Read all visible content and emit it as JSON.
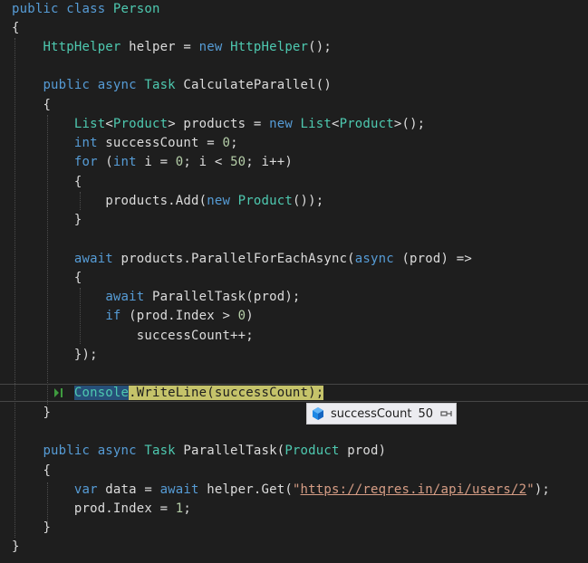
{
  "code": {
    "l1": {
      "kw1": "public",
      "kw2": "class",
      "name": "Person"
    },
    "l2": {
      "brace": "{"
    },
    "l3": {
      "type": "HttpHelper",
      "rest": " helper = ",
      "kw": "new",
      "type2": "HttpHelper",
      "end": "();"
    },
    "l4": {
      "kw1": "public",
      "kw2": "async",
      "type": "Task",
      "rest": " CalculateParallel()"
    },
    "l5": {
      "brace": "{"
    },
    "l6": {
      "type": "List",
      "lt": "<",
      "type2": "Product",
      "gt": "> products = ",
      "kw": "new",
      "type3": "List",
      "lt2": "<",
      "type4": "Product",
      "end": ">();"
    },
    "l7": {
      "kw": "int",
      "rest": " successCount = ",
      "num": "0",
      "end": ";"
    },
    "l8": {
      "kw": "for",
      "p1": " (",
      "kw2": "int",
      "p2": " i = ",
      "n1": "0",
      "p3": "; i < ",
      "n2": "50",
      "p4": "; i++)"
    },
    "l9": {
      "brace": "{"
    },
    "l10": {
      "pre": "products.Add(",
      "kw": "new",
      "sp": " ",
      "type": "Product",
      "end": "());"
    },
    "l11": {
      "brace": "}"
    },
    "l12": {
      "kw": "await",
      "pre": " products.ParallelForEachAsync(",
      "kw2": "async",
      "end": " (prod) =>"
    },
    "l13": {
      "brace": "{"
    },
    "l14": {
      "kw": "await",
      "rest": " ParallelTask(prod);"
    },
    "l15": {
      "kw": "if",
      "pre": " (prod.Index > ",
      "num": "0",
      "end": ")"
    },
    "l16": {
      "text": "successCount++;"
    },
    "l17": {
      "text": "});"
    },
    "l18": {
      "cls": "Console",
      "rest": ".WriteLine(successCount);"
    },
    "l19": {
      "brace": "}"
    },
    "l20": {
      "kw1": "public",
      "kw2": "async",
      "type": "Task",
      "pre": " ParallelTask(",
      "type2": "Product",
      "end": " prod)"
    },
    "l21": {
      "brace": "{"
    },
    "l22": {
      "kw": "var",
      "pre": " data = ",
      "kw2": "await",
      "mid": " helper.Get(",
      "q1": "\"",
      "url": "https://reqres.in/api/users/2",
      "q2": "\"",
      "end": ");"
    },
    "l23": {
      "text": "prod.Index = ",
      "num": "1",
      "end": ";"
    },
    "l24": {
      "brace": "}"
    },
    "l25": {
      "brace": "}"
    }
  },
  "datatip": {
    "name": "successCount",
    "value": "50",
    "icon": "variable-cube-icon",
    "pin_icon": "pin-icon"
  },
  "colors": {
    "background": "#1e1e1e",
    "keyword": "#569cd6",
    "type": "#4ec9b0",
    "text": "#dcdcdc",
    "number": "#b5cea8",
    "string": "#d69d85",
    "current_statement": "#c5c36a",
    "selection": "#264f78"
  }
}
